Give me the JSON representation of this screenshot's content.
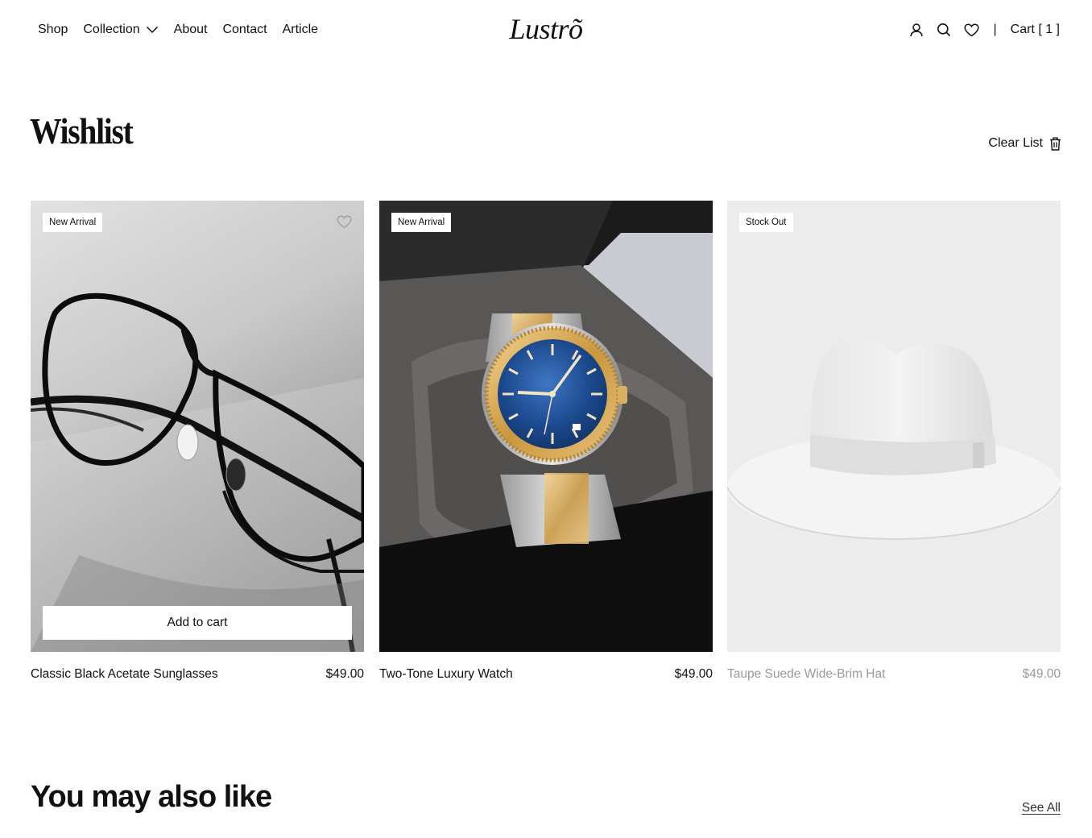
{
  "header": {
    "nav": [
      {
        "label": "Shop"
      },
      {
        "label": "Collection"
      },
      {
        "label": "About"
      },
      {
        "label": "Contact"
      },
      {
        "label": "Article"
      }
    ],
    "logo": "Lustrõ",
    "icons": [
      "user-icon",
      "search-icon",
      "heart-icon"
    ],
    "separator": "|",
    "cart_label": "Cart [ 1 ]"
  },
  "wishlist": {
    "title": "Wishlist",
    "clear_label": "Clear List",
    "products": [
      {
        "badge": "New Arrival",
        "name": "Classic Black Acetate Sunglasses",
        "price": "$49.00",
        "image": "black-eyeglasses-photo",
        "add_to_cart_label": "Add to cart"
      },
      {
        "badge": "New Arrival",
        "name": "Two-Tone Luxury Watch",
        "price": "$49.00",
        "image": "two-tone-watch-in-box-photo"
      },
      {
        "badge": "Stock Out",
        "name": "Taupe Suede Wide-Brim Hat",
        "price": "$49.00",
        "image": "white-wide-brim-hat-photo"
      }
    ]
  },
  "recommendations": {
    "title": "You may also like",
    "see_all_label": "See All"
  },
  "colors": {
    "text": "#111111",
    "muted_text": "#9a9a9a",
    "background": "#ffffff"
  }
}
